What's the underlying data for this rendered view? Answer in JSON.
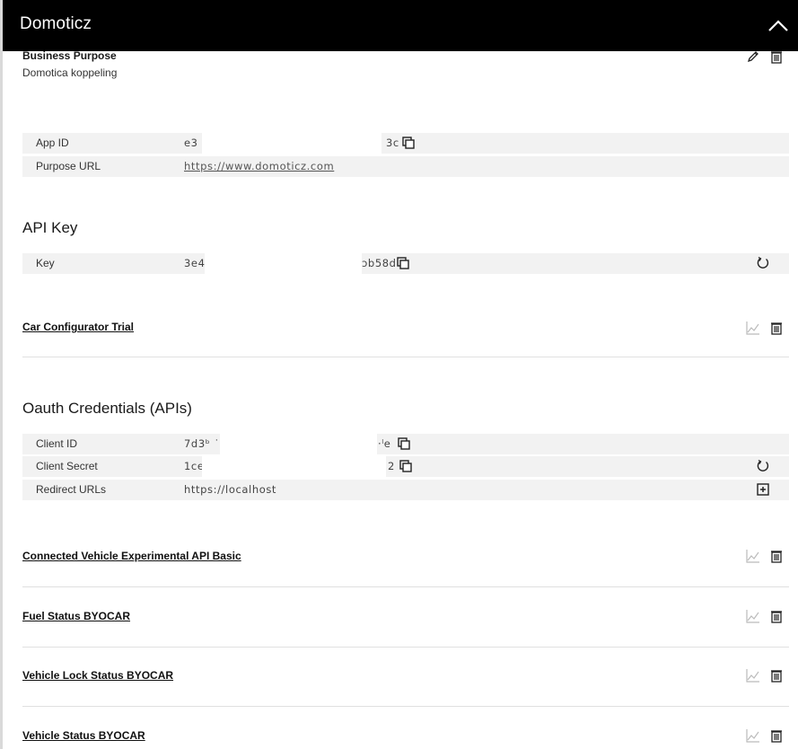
{
  "header": {
    "title": "Domoticz"
  },
  "business_purpose": {
    "title": "Business Purpose",
    "value": "Domotica koppeling"
  },
  "app_info": {
    "rows": [
      {
        "label": "App ID",
        "value_start": "e3",
        "value_end": "3c"
      },
      {
        "label": "Purpose URL",
        "value": "https://www.domoticz.com"
      }
    ]
  },
  "api_key": {
    "heading": "API Key",
    "label": "Key",
    "value_start": "3e4",
    "value_end": "ɔb58d"
  },
  "products": {
    "car_configurator": "Car Configurator Trial",
    "connected_vehicle": "Connected Vehicle Experimental API Basic",
    "fuel_status": "Fuel Status BYOCAR",
    "vehicle_lock": "Vehicle Lock Status BYOCAR",
    "vehicle_status": "Vehicle Status BYOCAR"
  },
  "oauth": {
    "heading": "Oauth Credentials (APIs)",
    "client_id": {
      "label": "Client ID",
      "value_start": "7d3ᵇ ˙",
      "value_end": "·ˡe"
    },
    "client_secret": {
      "label": "Client Secret",
      "value_start": "1ce",
      "value_end": "2"
    },
    "redirect": {
      "label": "Redirect URLs",
      "value": "https://localhost"
    }
  }
}
